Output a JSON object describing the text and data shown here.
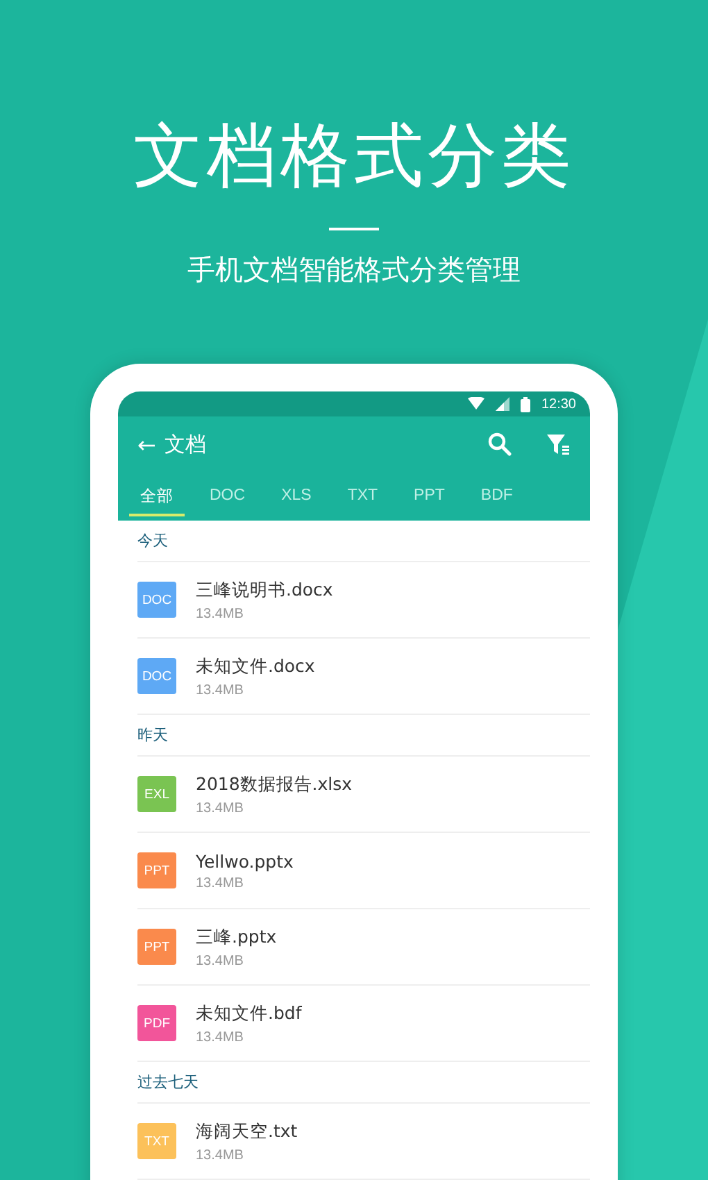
{
  "headline": "文档格式分类",
  "subtitle": "手机文档智能格式分类管理",
  "status_bar": {
    "time": "12:30"
  },
  "app_bar": {
    "back": "←",
    "title": "文档"
  },
  "tabs": [
    {
      "label": "全部",
      "selected": true
    },
    {
      "label": "DOC",
      "selected": false
    },
    {
      "label": "XLS",
      "selected": false
    },
    {
      "label": "TXT",
      "selected": false
    },
    {
      "label": "PPT",
      "selected": false
    },
    {
      "label": "BDF",
      "selected": false
    }
  ],
  "sections": [
    {
      "title": "今天",
      "files": [
        {
          "icon_label": "DOC",
          "color": "#5ea9f5",
          "name": "三峰说明书.docx",
          "size": "13.4MB"
        },
        {
          "icon_label": "DOC",
          "color": "#5ea9f5",
          "name": "未知文件.docx",
          "size": "13.4MB"
        }
      ]
    },
    {
      "title": "昨天",
      "files": [
        {
          "icon_label": "EXL",
          "color": "#7ac452",
          "name": "2018数据报告.xlsx",
          "size": "13.4MB"
        },
        {
          "icon_label": "PPT",
          "color": "#fa8a4c",
          "name": "Yellwo.pptx",
          "size": "13.4MB"
        },
        {
          "icon_label": "PPT",
          "color": "#fa8a4c",
          "name": "三峰.pptx",
          "size": "13.4MB"
        },
        {
          "icon_label": "PDF",
          "color": "#f2559a",
          "name": "未知文件.bdf",
          "size": "13.4MB"
        }
      ]
    },
    {
      "title": "过去七天",
      "files": [
        {
          "icon_label": "TXT",
          "color": "#fcc15a",
          "name": "海阔天空.txt",
          "size": "13.4MB"
        }
      ]
    }
  ]
}
